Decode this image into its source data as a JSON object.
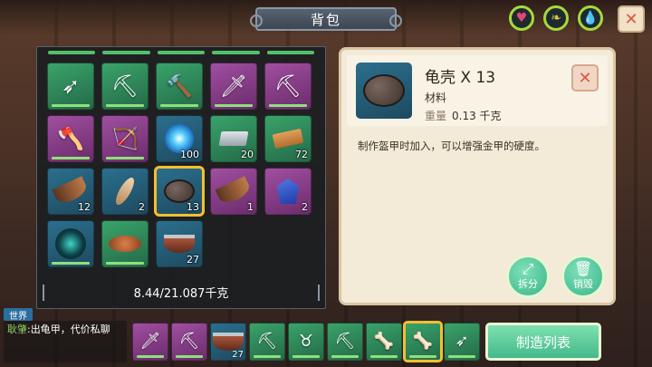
{
  "window": {
    "title": "背包",
    "close_symbol": "✕"
  },
  "status": [
    {
      "name": "health",
      "icon": "heart-icon",
      "glyph": "♥",
      "color": "#e0467a"
    },
    {
      "name": "hunger",
      "icon": "food-icon",
      "glyph": "❧",
      "color": "#d7c24e"
    },
    {
      "name": "thirst",
      "icon": "water-drop-icon",
      "glyph": "💧",
      "color": "#2fb3d6"
    }
  ],
  "inventory": {
    "weight_text": "8.44/21.087千克",
    "slots": [
      {
        "item": "crystal-spear",
        "glyph": "➶",
        "bg": "green",
        "count": ""
      },
      {
        "item": "pickaxe",
        "glyph": "⛏",
        "bg": "green",
        "count": ""
      },
      {
        "item": "hammer",
        "glyph": "🔨",
        "bg": "green",
        "count": ""
      },
      {
        "item": "sword",
        "glyph": "🗡",
        "bg": "purple",
        "count": ""
      },
      {
        "item": "pickaxe-2",
        "glyph": "⛏",
        "bg": "purple",
        "count": ""
      },
      {
        "item": "battle-axe",
        "glyph": "🪓",
        "bg": "purple",
        "count": ""
      },
      {
        "item": "bow",
        "glyph": "🏹",
        "bg": "purple",
        "count": ""
      },
      {
        "item": "blue-orb",
        "glyph": "",
        "bg": "blue",
        "count": "100"
      },
      {
        "item": "iron-ingot",
        "glyph": "",
        "bg": "green",
        "count": "20"
      },
      {
        "item": "wood-plank",
        "glyph": "",
        "bg": "green",
        "count": "72"
      },
      {
        "item": "horn",
        "glyph": "",
        "bg": "blue",
        "count": "12"
      },
      {
        "item": "feather",
        "glyph": "",
        "bg": "blue",
        "count": "2"
      },
      {
        "item": "turtle-shell",
        "glyph": "",
        "bg": "blue",
        "count": "13",
        "selected": true
      },
      {
        "item": "fang",
        "glyph": "",
        "bg": "purple",
        "count": "1"
      },
      {
        "item": "sapphire",
        "glyph": "",
        "bg": "purple",
        "count": "2"
      },
      {
        "item": "dark-orb",
        "glyph": "",
        "bg": "blue",
        "count": ""
      },
      {
        "item": "meat",
        "glyph": "",
        "bg": "green",
        "count": ""
      },
      {
        "item": "stew-bowl",
        "glyph": "",
        "bg": "blue",
        "count": "27"
      }
    ]
  },
  "detail": {
    "name": "龟壳 X 13",
    "type": "材料",
    "weight_label": "重量",
    "weight_value": "0.13 千克",
    "description": "制作盔甲时加入，可以增强金甲的硬度。",
    "split_label": "拆分",
    "destroy_label": "销毁",
    "close_symbol": "✕"
  },
  "chat": {
    "channel": "世界",
    "sender": "耿肇",
    "message": ":出龟甲，代价私聊"
  },
  "hotbar": [
    {
      "item": "sword",
      "glyph": "🗡",
      "bg": "purple",
      "count": ""
    },
    {
      "item": "pickaxe",
      "glyph": "⛏",
      "bg": "purple",
      "count": ""
    },
    {
      "item": "stew-bowl",
      "glyph": "",
      "bg": "blue",
      "count": "27"
    },
    {
      "item": "pickaxe-green",
      "glyph": "⛏",
      "bg": "green",
      "count": ""
    },
    {
      "item": "horn-item",
      "glyph": "♉",
      "bg": "green",
      "count": ""
    },
    {
      "item": "pickaxe-wood",
      "glyph": "⛏",
      "bg": "green",
      "count": ""
    },
    {
      "item": "club",
      "glyph": "🦴",
      "bg": "green",
      "count": ""
    },
    {
      "item": "club-selected",
      "glyph": "🦴",
      "bg": "green",
      "count": "",
      "selected": true
    },
    {
      "item": "crystal-spear",
      "glyph": "➶",
      "bg": "green",
      "count": ""
    }
  ],
  "craft_button": "制造列表"
}
